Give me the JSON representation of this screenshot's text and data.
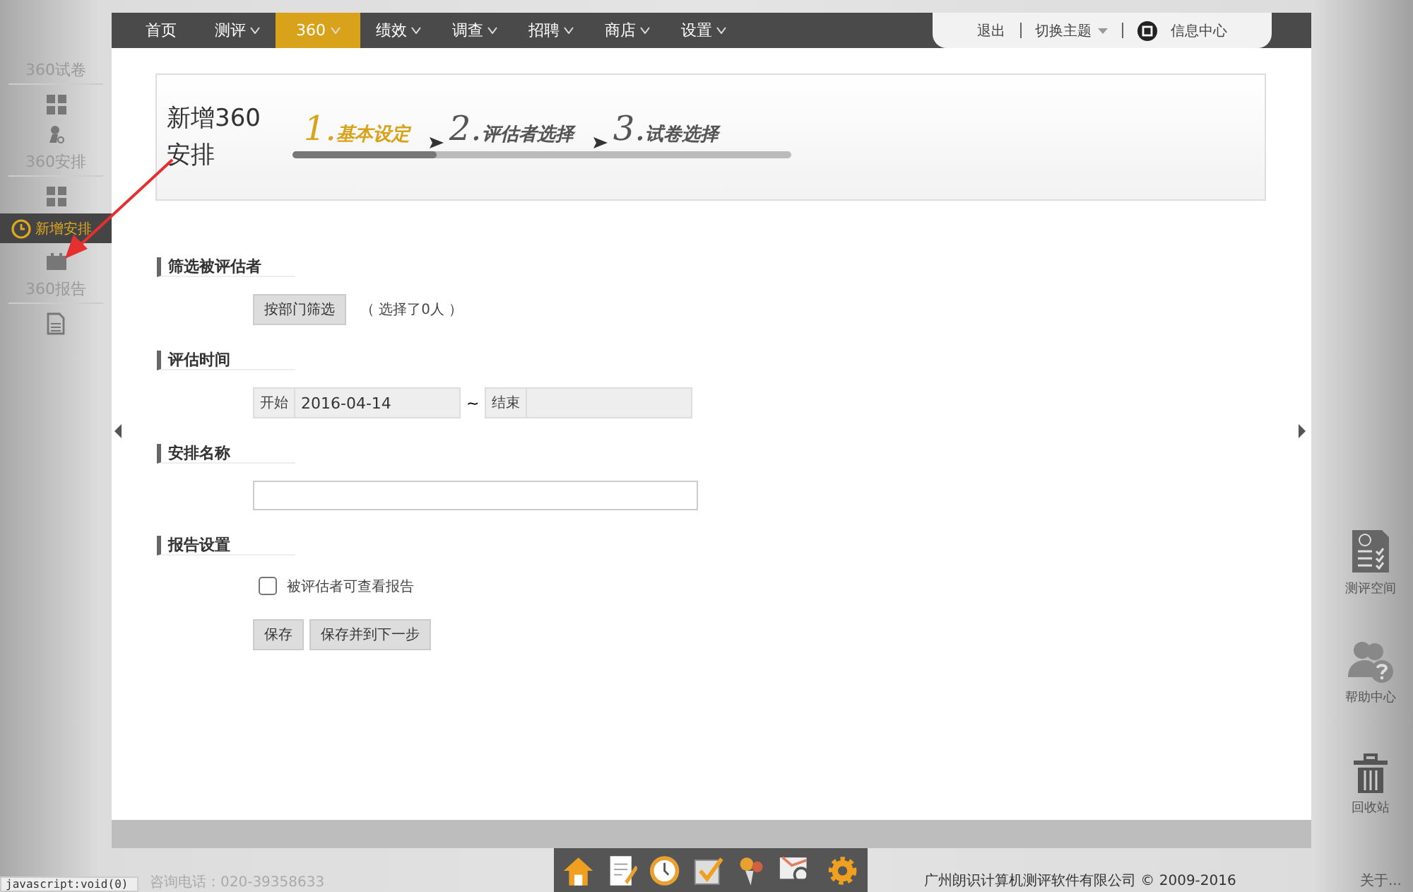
{
  "nav": {
    "items": [
      {
        "label": "首页",
        "dropdown": false,
        "selected": false
      },
      {
        "label": "测评",
        "dropdown": true,
        "selected": false
      },
      {
        "label": "360",
        "dropdown": true,
        "selected": true
      },
      {
        "label": "绩效",
        "dropdown": true,
        "selected": false
      },
      {
        "label": "调查",
        "dropdown": true,
        "selected": false
      },
      {
        "label": "招聘",
        "dropdown": true,
        "selected": false
      },
      {
        "label": "商店",
        "dropdown": true,
        "selected": false
      },
      {
        "label": "设置",
        "dropdown": true,
        "selected": false
      }
    ],
    "logout": "退出",
    "theme": "切换主题",
    "messages": "信息中心"
  },
  "sidebar": {
    "groups": [
      {
        "title": "360试卷",
        "items": [
          {
            "kind": "grid",
            "selected": false
          },
          {
            "kind": "person",
            "selected": false
          }
        ]
      },
      {
        "title": "360安排",
        "items": [
          {
            "kind": "grid",
            "selected": false
          },
          {
            "kind": "clock",
            "selected": true,
            "label": "新增安排"
          },
          {
            "kind": "calendar",
            "selected": false
          }
        ]
      },
      {
        "title": "360报告",
        "items": [
          {
            "kind": "document",
            "selected": false
          }
        ]
      }
    ]
  },
  "header": {
    "title": "新增360安排",
    "steps": [
      {
        "number": "1.",
        "label": "基本设定",
        "selected": true
      },
      {
        "number": "2.",
        "label": "评估者选择",
        "selected": false
      },
      {
        "number": "3.",
        "label": "试卷选择",
        "selected": false
      }
    ],
    "progress": {
      "level": 0.29
    }
  },
  "form": {
    "filter": {
      "title": "筛选被评估者",
      "button": "按部门筛选",
      "note": "（ 选择了0人 ）"
    },
    "time": {
      "title": "评估时间",
      "start_label": "开始",
      "start_value": "2016-04-14",
      "separator": "~",
      "end_label": "结束"
    },
    "name": {
      "title": "安排名称"
    },
    "report": {
      "title": "报告设置",
      "checkbox": {
        "label": "被评估者可查看报告",
        "checked": false
      }
    },
    "buttons": [
      "保存",
      "保存并到下一步"
    ]
  },
  "right_dock": [
    {
      "kind": "document",
      "label": "测评空间"
    },
    {
      "kind": "help",
      "label": "帮助中心"
    },
    {
      "kind": "trash",
      "label": "回收站"
    }
  ],
  "bottom_dock": [
    {
      "kind": "home"
    },
    {
      "kind": "note"
    },
    {
      "kind": "clock"
    },
    {
      "kind": "check"
    },
    {
      "kind": "pin"
    },
    {
      "kind": "search"
    },
    {
      "kind": "gear"
    }
  ],
  "footer": {
    "status": "javascript:void(0)",
    "phone": "咨询电话：020-39358633",
    "copyright": "广州朗识计算机测评软件有限公司 © 2009-2016",
    "about": "关于..."
  }
}
